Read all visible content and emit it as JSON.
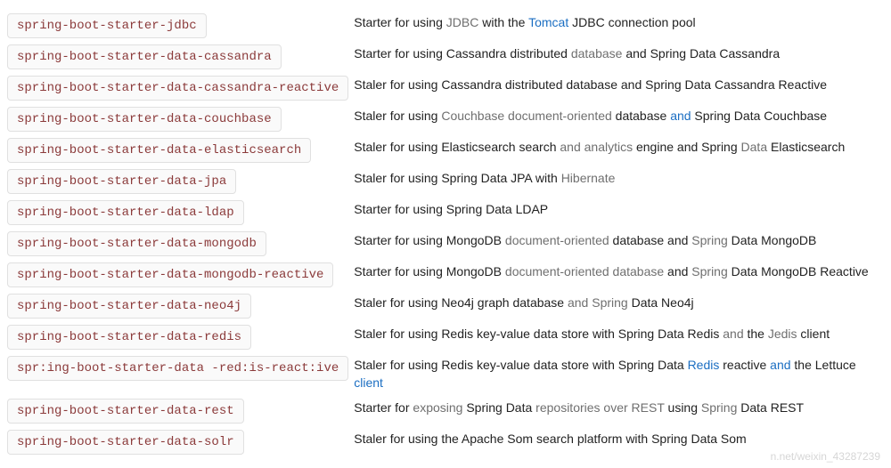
{
  "rows": [
    {
      "starter": "spring-boot-starter-jdbc",
      "desc_segments": [
        {
          "t": "Starter for using ",
          "c": ""
        },
        {
          "t": "JDBC",
          "c": "muted"
        },
        {
          "t": " with the ",
          "c": ""
        },
        {
          "t": "Tomcat",
          "c": "link"
        },
        {
          "t": " JDBC connection  pool",
          "c": ""
        }
      ]
    },
    {
      "starter": "spring-boot-starter-data-cassandra",
      "desc_segments": [
        {
          "t": "Starter for  using Cassandra  distributed ",
          "c": ""
        },
        {
          "t": "database",
          "c": "muted"
        },
        {
          "t": "  and Spring  Data Cassandra",
          "c": ""
        }
      ]
    },
    {
      "starter": "spring-boot-starter-data-cassandra-reactive",
      "desc_segments": [
        {
          "t": "Staler for using Cassandra  distributed database  and Spring  Data Cassandra  Reactive",
          "c": ""
        }
      ]
    },
    {
      "starter": "spring-boot-starter-data-couchbase",
      "desc_segments": [
        {
          "t": "Staler  for  using ",
          "c": ""
        },
        {
          "t": "Couchbase document-oriented",
          "c": "muted"
        },
        {
          "t": "  database  ",
          "c": ""
        },
        {
          "t": "and",
          "c": "link"
        },
        {
          "t": " Spring Data Couchbase",
          "c": ""
        }
      ]
    },
    {
      "starter": "spring-boot-starter-data-elasticsearch",
      "desc_segments": [
        {
          "t": "Staler  for using Elasticsearch search ",
          "c": ""
        },
        {
          "t": "and analytics",
          "c": "muted"
        },
        {
          "t": "  engine and Spring  ",
          "c": ""
        },
        {
          "t": "Data",
          "c": "muted"
        },
        {
          "t": "   Elasticsearch",
          "c": ""
        }
      ]
    },
    {
      "starter": "spring-boot-starter-data-jpa",
      "desc_segments": [
        {
          "t": "Staler for  using Spring Data JPA with  ",
          "c": ""
        },
        {
          "t": "Hibernate",
          "c": "muted"
        }
      ]
    },
    {
      "starter": "spring-boot-starter-data-ldap",
      "desc_segments": [
        {
          "t": "Starter for using Spring Data  LDAP",
          "c": ""
        }
      ]
    },
    {
      "starter": "spring-boot-starter-data-mongodb",
      "desc_segments": [
        {
          "t": "Starter for  using MongoDB ",
          "c": ""
        },
        {
          "t": "document-oriented",
          "c": "muted"
        },
        {
          "t": "  database and ",
          "c": ""
        },
        {
          "t": "Spring",
          "c": "muted"
        },
        {
          "t": "  Data MongoDB",
          "c": ""
        }
      ]
    },
    {
      "starter": "spring-boot-starter-data-mongodb-reactive",
      "desc_segments": [
        {
          "t": "Starter for using MongoDB ",
          "c": ""
        },
        {
          "t": "document-oriented  database",
          "c": "muted"
        },
        {
          "t": " and ",
          "c": ""
        },
        {
          "t": "Spring",
          "c": "muted"
        },
        {
          "t": "  Data MongoDB  Reactive",
          "c": ""
        }
      ]
    },
    {
      "starter": "spring-boot-starter-data-neo4j",
      "desc_segments": [
        {
          "t": "Staler for  using Neo4j graph database  ",
          "c": ""
        },
        {
          "t": "and Spring",
          "c": "muted"
        },
        {
          "t": " Data  Neo4j",
          "c": ""
        }
      ]
    },
    {
      "starter": "spring-boot-starter-data-redis",
      "desc_segments": [
        {
          "t": "Staler  for using Redis key-value  data store with  Spring Data Redis ",
          "c": ""
        },
        {
          "t": "and",
          "c": "muted"
        },
        {
          "t": " the ",
          "c": ""
        },
        {
          "t": "Jedis",
          "c": "muted"
        },
        {
          "t": "   client",
          "c": ""
        }
      ]
    },
    {
      "starter": "spr:ing-boot-starter-data -red:is-react:ive",
      "desc_segments": [
        {
          "t": "Staler  for using Redis key-value data store with  Spring Data ",
          "c": ""
        },
        {
          "t": "Redis",
          "c": "link"
        },
        {
          "t": " reactive ",
          "c": ""
        },
        {
          "t": "and",
          "c": "link"
        },
        {
          "t": " the Lettuce ",
          "c": ""
        },
        {
          "t": "client",
          "c": "link"
        }
      ]
    },
    {
      "starter": "spring-boot-starter-data-rest",
      "desc_segments": [
        {
          "t": "Starter for ",
          "c": ""
        },
        {
          "t": "exposing",
          "c": "muted"
        },
        {
          "t": " Spring Data ",
          "c": ""
        },
        {
          "t": "repositories over REST",
          "c": "muted"
        },
        {
          "t": " using ",
          "c": ""
        },
        {
          "t": "Spring",
          "c": "muted"
        },
        {
          "t": " Data    REST",
          "c": ""
        }
      ]
    },
    {
      "starter": "spring-boot-starter-data-solr",
      "desc_segments": [
        {
          "t": "Staler  for using the Apache  Som search  platform with Spring Data  Som",
          "c": ""
        }
      ]
    }
  ],
  "watermark": "n.net/weixin_43287239"
}
